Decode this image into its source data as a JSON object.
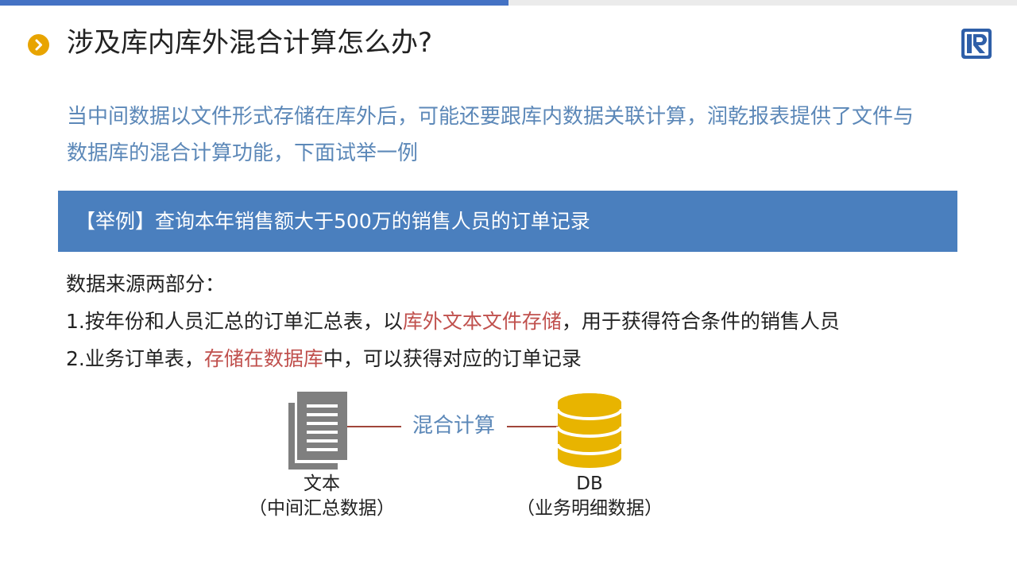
{
  "slide": {
    "title": "涉及库内库外混合计算怎么办?",
    "intro_lines": [
      "当中间数据以文件形式存储在库外后，可能还要跟库内数据关联计算，润乾报表提供了文件与",
      "数据库的混合计算功能，下面试举一例"
    ],
    "banner": "【举例】查询本年销售额大于500万的销售人员的订单记录",
    "body": {
      "line1": "数据来源两部分：",
      "line2_prefix": "1.按年份和人员汇总的订单汇总表，以",
      "line2_highlight": "库外文本文件存储",
      "line2_suffix": "，用于获得符合条件的销售人员",
      "line3_prefix": "2.业务订单表，",
      "line3_highlight": "存储在数据库",
      "line3_suffix": "中，可以获得对应的订单记录"
    },
    "diagram": {
      "connector_label": "混合计算",
      "left_caption_1": "文本",
      "left_caption_2": "（中间汇总数据）",
      "right_caption_1": "DB",
      "right_caption_2": "（业务明细数据）"
    }
  },
  "colors": {
    "accent_blue": "#4472c4",
    "banner_blue": "#4a7fbe",
    "intro_text": "#5c88b8",
    "highlight_red": "#c0504d",
    "bullet_orange": "#e8a400",
    "db_gold": "#e8b400",
    "doc_gray": "#7f7f7f"
  },
  "icons": [
    "chevron-right-icon",
    "logo-icon",
    "document-icon",
    "database-icon"
  ]
}
